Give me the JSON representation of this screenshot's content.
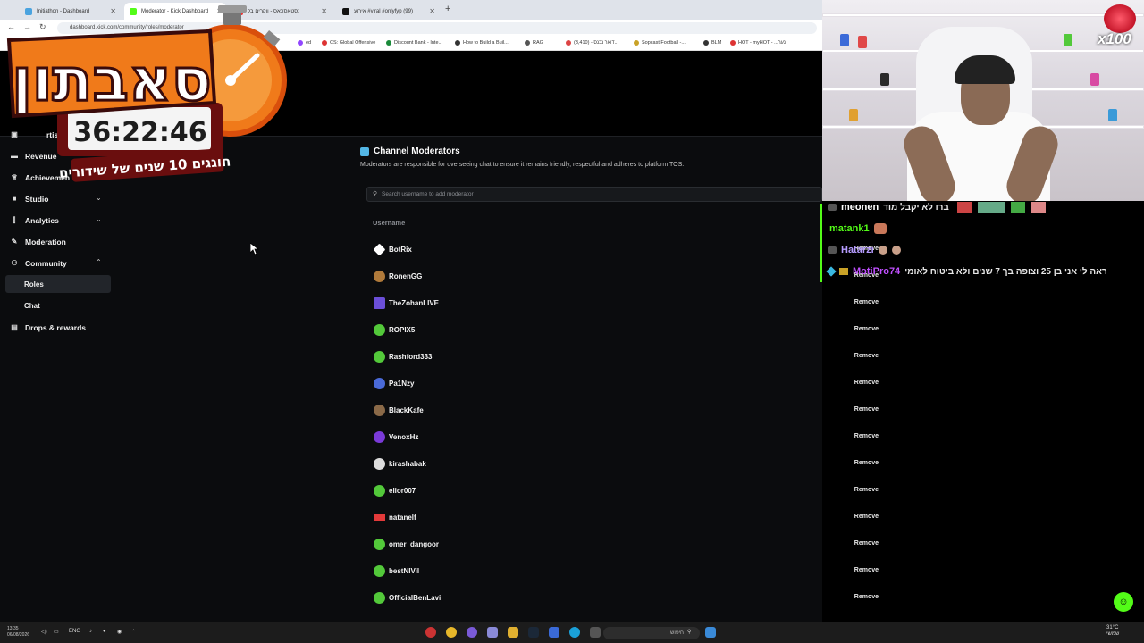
{
  "browser": {
    "tabs": [
      {
        "label": "Initiathon - Dashboard",
        "color": "#4aa3df"
      },
      {
        "label": "Moderator - Kick Dashboard",
        "color": "#53fc18"
      },
      {
        "label": "נסטאסונאס - ווקרים בל",
        "color": "#e33"
      },
      {
        "label": "אירוע #viral #onlyfyp (99)",
        "color": "#111"
      }
    ],
    "url": "dashboard.kick.com/community/roles/moderator",
    "bookmarks": [
      "ownload",
      "ison",
      "ed",
      "CS: Global Offensive",
      "Discount Bank - Inte...",
      "How to Build a Buil...",
      "RAG",
      "(3,410) - דואר נכנס...",
      "Sopcast Football -...",
      "BLM",
      "HOT - myHOT - ...נער"
    ]
  },
  "sidebar": {
    "items": [
      {
        "label": "rtisem",
        "icon": "megaphone-icon"
      },
      {
        "label": "Revenue",
        "icon": "revenue-icon"
      },
      {
        "label": "Achievemen",
        "icon": "trophy-icon"
      },
      {
        "label": "Studio",
        "icon": "camera-icon"
      },
      {
        "label": "Analytics",
        "icon": "chart-icon"
      },
      {
        "label": "Moderation",
        "icon": "wrench-icon"
      },
      {
        "label": "Community",
        "icon": "people-icon"
      },
      {
        "label": "Drops & rewards",
        "icon": "gift-icon"
      }
    ],
    "sub_items": [
      "Roles",
      "Chat"
    ]
  },
  "main": {
    "title": "Channel Moderators",
    "description": "Moderators are responsible for overseeing chat to ensure it remains friendly, respectful and adheres to platform TOS.",
    "search_placeholder": "Search username to add moderator",
    "column_header": "Username",
    "remove_label": "Remove",
    "moderators": [
      {
        "name": "BotRix",
        "color": "#ffffff",
        "shape": "diamond"
      },
      {
        "name": "RonenGG",
        "color": "#b07a3a",
        "shape": "circle"
      },
      {
        "name": "TheZohanLIVE",
        "color": "#6b4fd8",
        "shape": "z"
      },
      {
        "name": "ROPIX5",
        "color": "#53c93a",
        "shape": "circle"
      },
      {
        "name": "Rashford333",
        "color": "#53c93a",
        "shape": "circle"
      },
      {
        "name": "Pa1Nzy",
        "color": "#4a6ad8",
        "shape": "circle"
      },
      {
        "name": "BlackKafe",
        "color": "#8b6a48",
        "shape": "circle"
      },
      {
        "name": "VenoxHz",
        "color": "#7a3ad8",
        "shape": "circle"
      },
      {
        "name": "kirashabak",
        "color": "#dddddd",
        "shape": "circle"
      },
      {
        "name": "elior007",
        "color": "#53c93a",
        "shape": "circle"
      },
      {
        "name": "natanelf",
        "color": "#e33a3a",
        "shape": "af"
      },
      {
        "name": "omer_dangoor",
        "color": "#53c93a",
        "shape": "circle"
      },
      {
        "name": "bestNIVil",
        "color": "#53c93a",
        "shape": "circle"
      },
      {
        "name": "OfficialBenLavi",
        "color": "#53c93a",
        "shape": "circle"
      }
    ]
  },
  "overlay": {
    "title": "סאבתון",
    "timer": "36:22:46",
    "subtitle": "חוגגים 10 שנים של שידורים",
    "multiplier": "x100"
  },
  "chat": [
    {
      "user": "meonen",
      "message": "ברו לא יקבל מוד",
      "color": "#ffffff"
    },
    {
      "user": "matank1",
      "message": "",
      "color": "#53fc18"
    },
    {
      "user": "Hatarzi",
      "message": "",
      "color": "#b69cff"
    },
    {
      "user": "MotiPro74",
      "message": "ראה לי אני בן 25 וצופה בך 7 שנים ולא ביטוח לאומי",
      "color": "#c050ff"
    }
  ],
  "taskbar": {
    "time": "13:35",
    "date": "06/08/2026",
    "lang": "ENG",
    "search": "חיפוש",
    "temp": "31°C",
    "weather": "שמשי"
  }
}
